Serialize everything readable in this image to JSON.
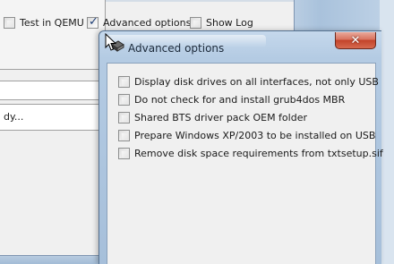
{
  "main_window": {
    "options": [
      {
        "label": "Test in QEMU",
        "checked": false
      },
      {
        "label": "Advanced options",
        "checked": true
      },
      {
        "label": "Show Log",
        "checked": false
      }
    ],
    "partial_button_label": "dy..."
  },
  "dialog": {
    "title": "Advanced options",
    "close_symbol": "✕",
    "options": [
      {
        "label": "Display disk drives on all interfaces, not only USB",
        "checked": false
      },
      {
        "label": "Do not check for and install grub4dos MBR",
        "checked": false
      },
      {
        "label": "Shared BTS driver pack OEM folder",
        "checked": false
      },
      {
        "label": "Prepare Windows XP/2003 to be installed on USB",
        "checked": false
      },
      {
        "label": "Remove disk space requirements from txtsetup.sif",
        "checked": false
      }
    ]
  },
  "colors": {
    "window_bg": "#f0f0f0",
    "frame_blue": "#b4cbe3",
    "close_red": "#c3432a",
    "check_mark": "#1f3f77"
  },
  "icons": [
    "title-app-icon",
    "close-icon",
    "mouse-cursor-icon",
    "check-mark-icon"
  ]
}
